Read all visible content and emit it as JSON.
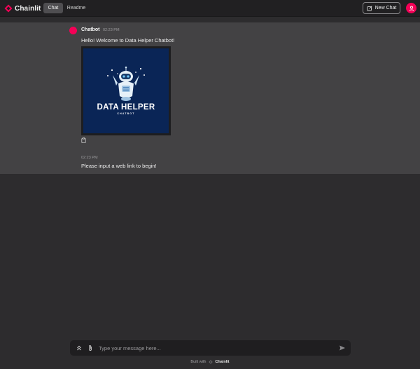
{
  "header": {
    "brand_name": "Chainlit",
    "tabs": [
      {
        "label": "Chat",
        "active": true
      },
      {
        "label": "Readme",
        "active": false
      }
    ],
    "new_chat_label": "New Chat"
  },
  "messages": {
    "author": "Chatbot",
    "first_time": "02:23 PM",
    "first_text": "Hello! Welcome to Data Helper Chatbot!",
    "image": {
      "title": "DATA HELPER",
      "subtitle": "CHATBOT"
    },
    "second_time": "02:23 PM",
    "second_text": "Please input a web link to begin!"
  },
  "composer": {
    "placeholder": "Type your message here..."
  },
  "footer": {
    "built_with": "Built with",
    "brand": "Chainlit"
  },
  "colors": {
    "accent": "#f50057",
    "background": "#2d2c2e",
    "message_area": "#434244",
    "header": "#212022",
    "image_bg": "#0a2556"
  },
  "icons": [
    "chainlit-logo-icon",
    "edit-icon",
    "user-icon",
    "copy-icon",
    "expand-up-icon",
    "paperclip-icon",
    "send-icon"
  ]
}
